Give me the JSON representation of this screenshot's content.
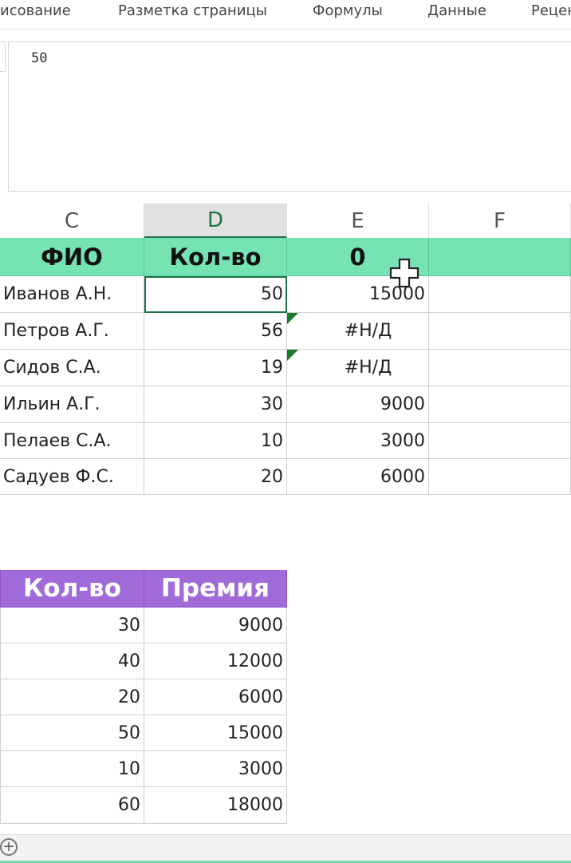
{
  "ribbon": {
    "tabs": [
      "исование",
      "Разметка страницы",
      "Формулы",
      "Данные",
      "Рецен"
    ]
  },
  "formula_bar": {
    "value": "50"
  },
  "columns": [
    "C",
    "D",
    "E",
    "F"
  ],
  "table1": {
    "headers": [
      "ФИО",
      "Кол-во",
      "0",
      ""
    ],
    "rows": [
      [
        "Иванов А.Н.",
        "50",
        "15000",
        ""
      ],
      [
        "Петров А.Г.",
        "56",
        "#Н/Д",
        ""
      ],
      [
        "Сидов С.А.",
        "19",
        "#Н/Д",
        ""
      ],
      [
        "Ильин А.Г.",
        "30",
        "9000",
        ""
      ],
      [
        "Пелаев С.А.",
        "10",
        "3000",
        ""
      ],
      [
        "Садуев Ф.С.",
        "20",
        "6000",
        ""
      ]
    ]
  },
  "table2": {
    "headers": [
      "Кол-во",
      "Премия"
    ],
    "rows": [
      [
        "30",
        "9000"
      ],
      [
        "40",
        "12000"
      ],
      [
        "20",
        "6000"
      ],
      [
        "50",
        "15000"
      ],
      [
        "10",
        "3000"
      ],
      [
        "60",
        "18000"
      ]
    ]
  },
  "colors": {
    "header1_bg": "#76e3b5",
    "header2_bg": "#a06ad8",
    "active_border": "#217346",
    "error_triangle": "#1e7b2e"
  },
  "icons": {
    "add_sheet": "plus-circle-icon",
    "cursor": "cell-select-cross-cursor"
  }
}
